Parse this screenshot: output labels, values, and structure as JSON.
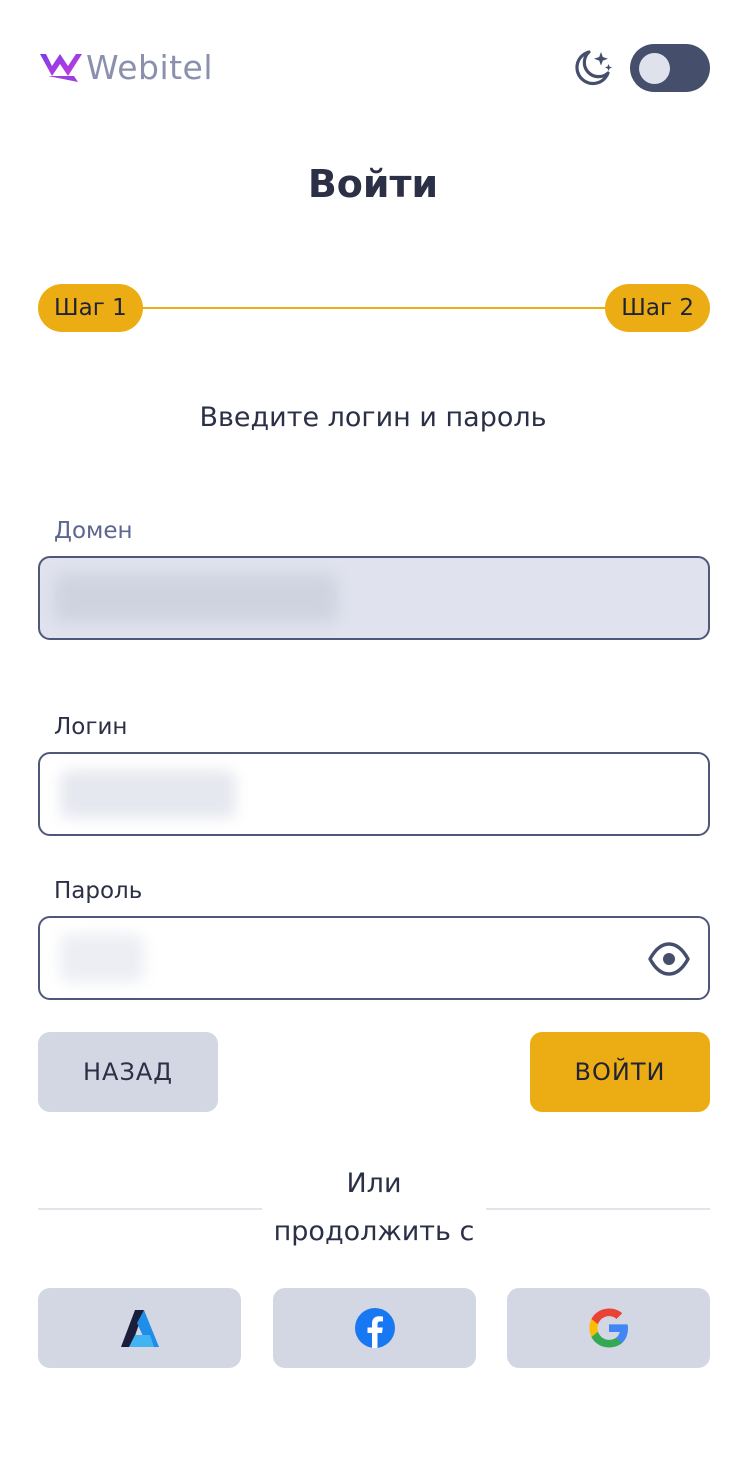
{
  "brand": {
    "name": "Webitel"
  },
  "theme": {
    "icon": "moon-stars-icon",
    "toggle_state": "off"
  },
  "page": {
    "title": "Войти"
  },
  "steps": [
    {
      "label": "Шаг 1"
    },
    {
      "label": "Шаг 2"
    }
  ],
  "form": {
    "subtitle": "Введите логин и пароль",
    "domain_label": "Домен",
    "login_label": "Логин",
    "password_label": "Пароль"
  },
  "buttons": {
    "back_label": "НАЗАД",
    "login_label": "ВОЙТИ"
  },
  "divider": {
    "text": "Или продолжить с"
  },
  "social": [
    {
      "name": "azure",
      "icon": "azure-icon"
    },
    {
      "name": "facebook",
      "icon": "facebook-icon"
    },
    {
      "name": "google",
      "icon": "google-icon"
    }
  ],
  "colors": {
    "accent": "#ecad14",
    "border": "#4f587a",
    "secondary_button": "#d3d7e3",
    "text": "#2b3046"
  }
}
